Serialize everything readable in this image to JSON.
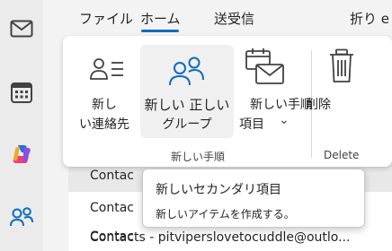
{
  "tabs": [
    {
      "label": "ファイル"
    },
    {
      "label": "ホーム"
    },
    {
      "label": "送受信"
    },
    {
      "label": "折り e"
    }
  ],
  "rail": {
    "items": [
      {
        "icon": "mail-icon"
      },
      {
        "icon": "calendar-icon"
      },
      {
        "icon": "copilot-icon"
      },
      {
        "icon": "people-icon"
      }
    ]
  },
  "ribbon": {
    "buttons": {
      "new_contact_line1": "新し",
      "new_contact_line2": "い連絡先",
      "new_group_line1": "新しい 正しい",
      "new_group_line2": "グループ",
      "new_item_line1": "新しい手順",
      "new_item_line2": "項目",
      "new_item_chevron": "⌄",
      "delete": "削除"
    },
    "groups": {
      "new_group_label": "新しい手順",
      "delete_group_label": "Delete"
    }
  },
  "list": {
    "rows": [
      {
        "text": "Contac"
      },
      {
        "text": "Contac"
      },
      {
        "text": "Contac"
      },
      {
        "text": "Contacts - pitviperslovetocuddle@outlo..."
      }
    ]
  },
  "tooltip": {
    "title": "新しいセカンダリ項目",
    "description": "新しいアイテムを作成する。"
  },
  "colors": {
    "accent": "#0f6cbd",
    "rail_bg": "#ebebeb"
  }
}
